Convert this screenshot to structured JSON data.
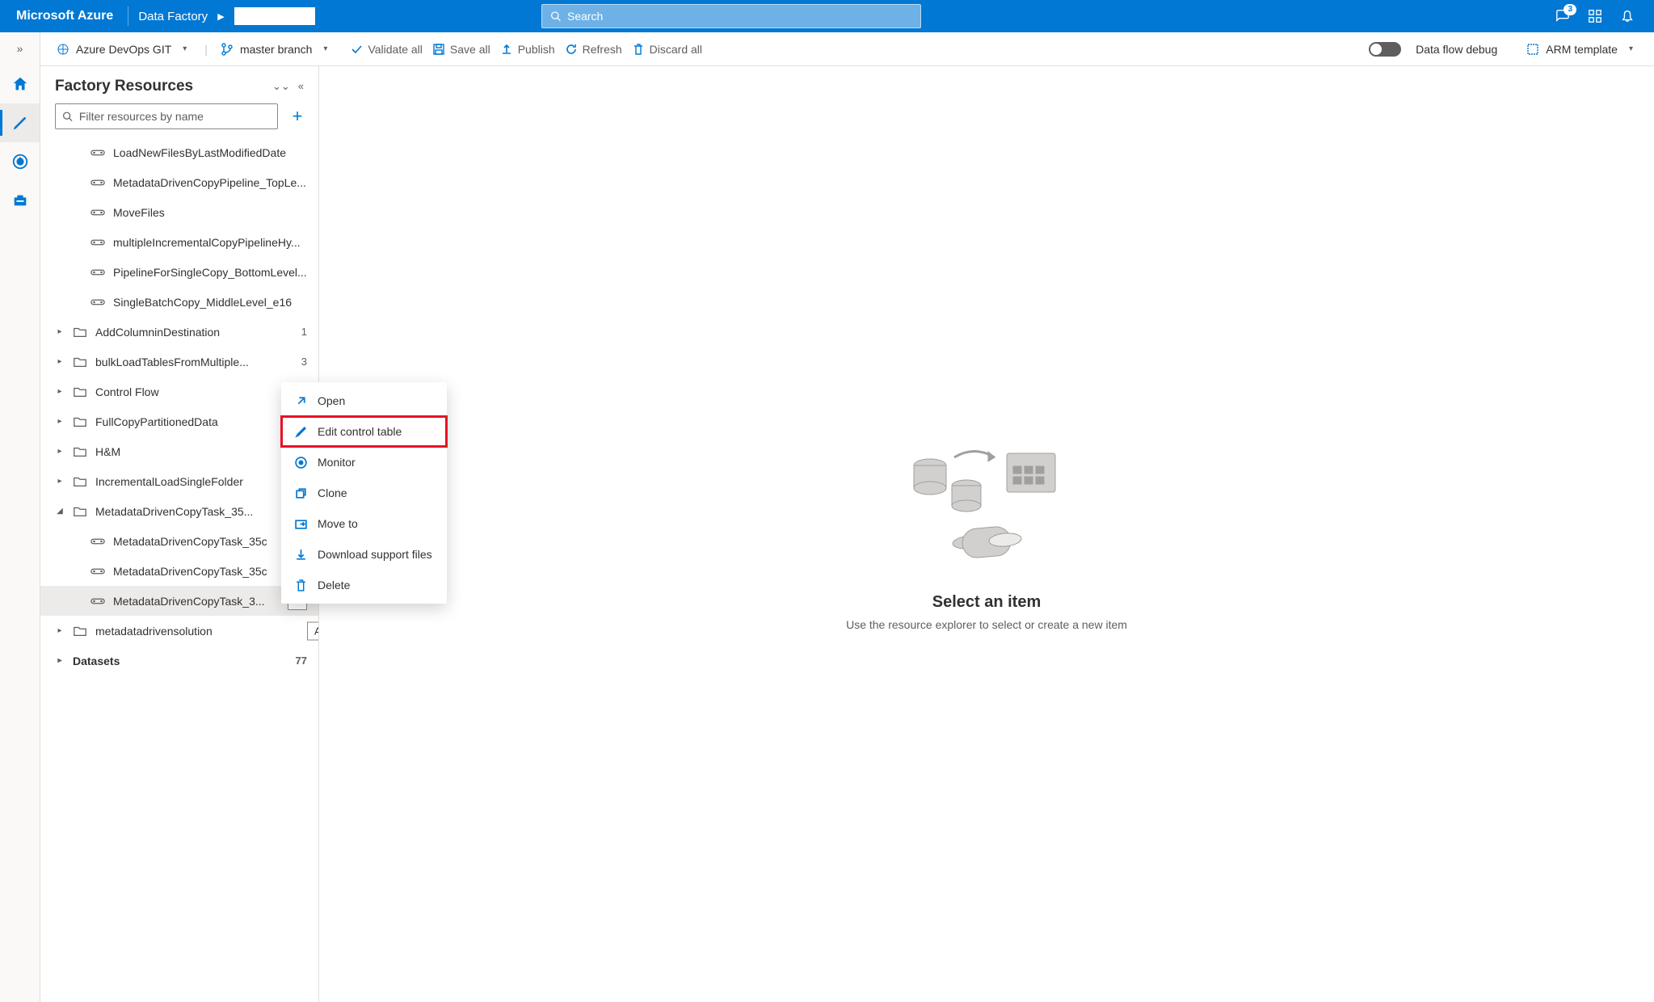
{
  "header": {
    "brand": "Microsoft Azure",
    "breadcrumb_item": "Data Factory",
    "search_placeholder": "Search",
    "notif_badge": "3"
  },
  "toolbar": {
    "git_label": "Azure DevOps GIT",
    "branch_label": "master branch",
    "validate": "Validate all",
    "save": "Save all",
    "publish": "Publish",
    "refresh": "Refresh",
    "discard": "Discard all",
    "debug_label": "Data flow debug",
    "arm_label": "ARM template"
  },
  "resources": {
    "title": "Factory Resources",
    "filter_placeholder": "Filter resources by name",
    "actions_tooltip": "Actions"
  },
  "tree": {
    "pipelines": [
      "LoadNewFilesByLastModifiedDate",
      "MetadataDrivenCopyPipeline_TopLe...",
      "MoveFiles",
      "multipleIncrementalCopyPipelineHy...",
      "PipelineForSingleCopy_BottomLevel...",
      "SingleBatchCopy_MiddleLevel_e16"
    ],
    "folders": [
      {
        "name": "AddColumninDestination",
        "count": "1"
      },
      {
        "name": "bulkLoadTablesFromMultiple...",
        "count": "3"
      },
      {
        "name": "Control Flow",
        "count": ""
      },
      {
        "name": "FullCopyPartitionedData",
        "count": ""
      },
      {
        "name": "H&M",
        "count": ""
      },
      {
        "name": "IncrementalLoadSingleFolder",
        "count": ""
      }
    ],
    "open_folder": {
      "name": "MetadataDrivenCopyTask_35...",
      "children": [
        "MetadataDrivenCopyTask_35c",
        "MetadataDrivenCopyTask_35c",
        "MetadataDrivenCopyTask_3..."
      ]
    },
    "last_folder": {
      "name": "metadatadrivensolution",
      "count": ""
    },
    "datasets_label": "Datasets",
    "datasets_count": "77"
  },
  "context_menu": {
    "open": "Open",
    "edit": "Edit control table",
    "monitor": "Monitor",
    "clone": "Clone",
    "move": "Move to",
    "download": "Download support files",
    "delete": "Delete"
  },
  "canvas": {
    "title": "Select an item",
    "subtitle": "Use the resource explorer to select or create a new item"
  }
}
